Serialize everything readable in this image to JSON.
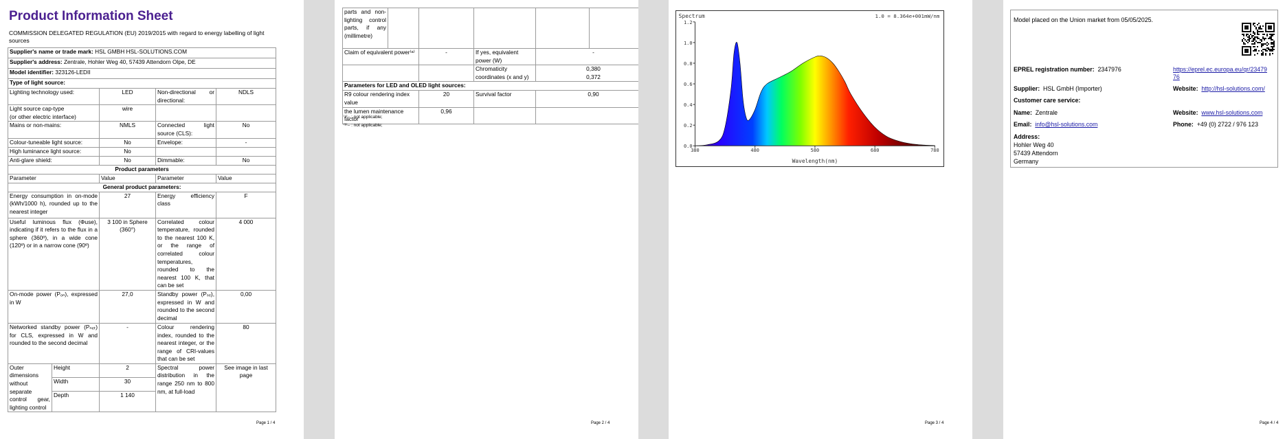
{
  "page1": {
    "title": "Product Information Sheet",
    "regulation": "COMMISSION DELEGATED REGULATION (EU) 2019/2015 with regard to energy labelling of light sources",
    "supplier_name_label": "Supplier's name or trade mark:",
    "supplier_name_value": "HSL GMBH HSL-SOLUTIONS.COM",
    "supplier_address_label": "Supplier's address:",
    "supplier_address_value": "Zentrale, Hohler Weg 40, 57439 Attendorn Olpe, DE",
    "model_label": "Model identifier:",
    "model_value": "323126-LEDII",
    "type_label": "Type of light source:",
    "rows": {
      "lighting_tech_label": "Lighting technology used:",
      "lighting_tech_value": "LED",
      "non_directional_label": "Non-directional or directional:",
      "non_directional_value": "NDLS",
      "cap_label_1": "Light source cap-type",
      "cap_label_2": "(or other electric interface)",
      "cap_value": "wire",
      "mains_label": "Mains or non-mains:",
      "mains_value": "NMLS",
      "cls_label": "Connected light source (CLS):",
      "cls_value": "No",
      "colour_tune_label": "Colour-tuneable light source:",
      "colour_tune_value": "No",
      "envelope_label": "Envelope:",
      "envelope_value": "-",
      "high_lum_label": "High luminance light source:",
      "high_lum_value": "No",
      "anti_glare_label": "Anti-glare shield:",
      "anti_glare_value": "No",
      "dimmable_label": "Dimmable:",
      "dimmable_value": "No"
    },
    "product_parameters": "Product parameters",
    "col_parameter": "Parameter",
    "col_value": "Value",
    "general_params": "General product parameters:",
    "energy_label": "Energy consumption in on-mode (kWh/1000 h), rounded up to the nearest integer",
    "energy_value": "27",
    "efficiency_label": "Energy efficiency class",
    "efficiency_value": "F",
    "flux_label": "Useful luminous flux (Φuse), indicating if it refers to the flux in a sphere (360º), in a wide cone (120º) or in a narrow cone (90º)",
    "flux_value": "3 100 in Sphere (360°)",
    "cct_label": "Correlated colour temperature, rounded to the nearest 100 K, or the range of correlated colour temperatures, rounded to the nearest 100 K, that can be set",
    "cct_value": "4 000",
    "onpower_label": "On-mode power (Pₒₙ), expressed in W",
    "onpower_value": "27,0",
    "standby_label": "Standby power (Pₛₑ), expressed in W and rounded to the second decimal",
    "standby_value": "0,00",
    "netstandby_label": "Networked standby power (Pₙₑₜ) for CLS, expressed in W and rounded to the second decimal",
    "netstandby_value": "-",
    "cri_label": "Colour rendering index, rounded to the nearest integer, or the range of CRI-values that can be set",
    "cri_value": "80",
    "outer_label": "Outer dimensions without separate control gear, lighting control",
    "height_label": "Height",
    "height_value": "2",
    "width_label": "Width",
    "width_value": "30",
    "depth_label": "Depth",
    "depth_value": "1 140",
    "spd_label": "Spectral power distribution in the range 250 nm to 800 nm, at full-load",
    "spd_value": "See image in last page",
    "page_num": "Page 1 / 4"
  },
  "page2": {
    "cont_label": "parts and non-lighting control parts, if any (millimetre)",
    "equiv_label": "Claim of equivalent power⁽ᵃ⁾",
    "equiv_value": "-",
    "ifyes_label": "If yes, equivalent power (W)",
    "ifyes_value": "-",
    "chroma_label": "Chromaticity coordinates (x and y)",
    "chroma_x": "0,380",
    "chroma_y": "0,372",
    "led_params": "Parameters for LED and OLED light sources:",
    "r9_label": "R9 colour rendering index value",
    "r9_value": "20",
    "survival_label": "Survival factor",
    "survival_value": "0,90",
    "lumen_label": "the lumen maintenance factor",
    "lumen_value": "0,96",
    "footnote_a": "⁽ᵃ⁾– : not applicable;",
    "footnote_b": "⁽ᵇ⁾– : not applicable;",
    "page_num": "Page 2 / 4"
  },
  "page3": {
    "page_num": "Page 3 / 4"
  },
  "chart_data": {
    "type": "area",
    "title": "Spectrum",
    "scale_note": "1.0 = 8.364e+001mW/nm",
    "xlabel": "Wavelength(nm)",
    "ylabel": "",
    "xlim": [
      380,
      780
    ],
    "ylim": [
      0.0,
      1.2
    ],
    "x_ticks": [
      "380",
      "480",
      "580",
      "680",
      "780"
    ],
    "y_ticks": [
      "0.0",
      "0.2",
      "0.4",
      "0.6",
      "0.8",
      "1.0",
      "1.2"
    ],
    "grid": false,
    "x": [
      380,
      400,
      420,
      430,
      440,
      445,
      450,
      455,
      460,
      465,
      470,
      480,
      490,
      500,
      520,
      540,
      560,
      580,
      590,
      600,
      610,
      620,
      630,
      640,
      660,
      680,
      700,
      720,
      740,
      760,
      780
    ],
    "values": [
      0.0,
      0.01,
      0.05,
      0.18,
      0.55,
      0.9,
      1.0,
      0.8,
      0.45,
      0.28,
      0.25,
      0.35,
      0.52,
      0.6,
      0.66,
      0.72,
      0.8,
      0.86,
      0.87,
      0.85,
      0.8,
      0.72,
      0.62,
      0.5,
      0.32,
      0.18,
      0.09,
      0.045,
      0.02,
      0.008,
      0.003
    ]
  },
  "page4": {
    "model_placed": "Model placed on the Union market from 05/05/2025.",
    "eprel_label": "EPREL registration number:",
    "eprel_value": "2347976",
    "eprel_link": "https://eprel.ec.europa.eu/qr/2347976",
    "supplier_label": "Supplier:",
    "supplier_value": "HSL GmbH (Importer)",
    "website_label": "Website:",
    "website1_value": "http://hsl-solutions.com/",
    "customer_care": "Customer care service:",
    "name_label": "Name:",
    "name_value": "Zentrale",
    "website2_value": "www.hsl-solutions.com",
    "email_label": "Email:",
    "email_value": "info@hsl-solutions.com",
    "phone_label": "Phone:",
    "phone_value": "+49 (0) 2722 / 976 123",
    "address_label": "Address:",
    "address_line1": "Hohler Weg 40",
    "address_line2": "57439 Attendorn",
    "address_line3": "Germany",
    "page_num": "Page 4 / 4"
  }
}
